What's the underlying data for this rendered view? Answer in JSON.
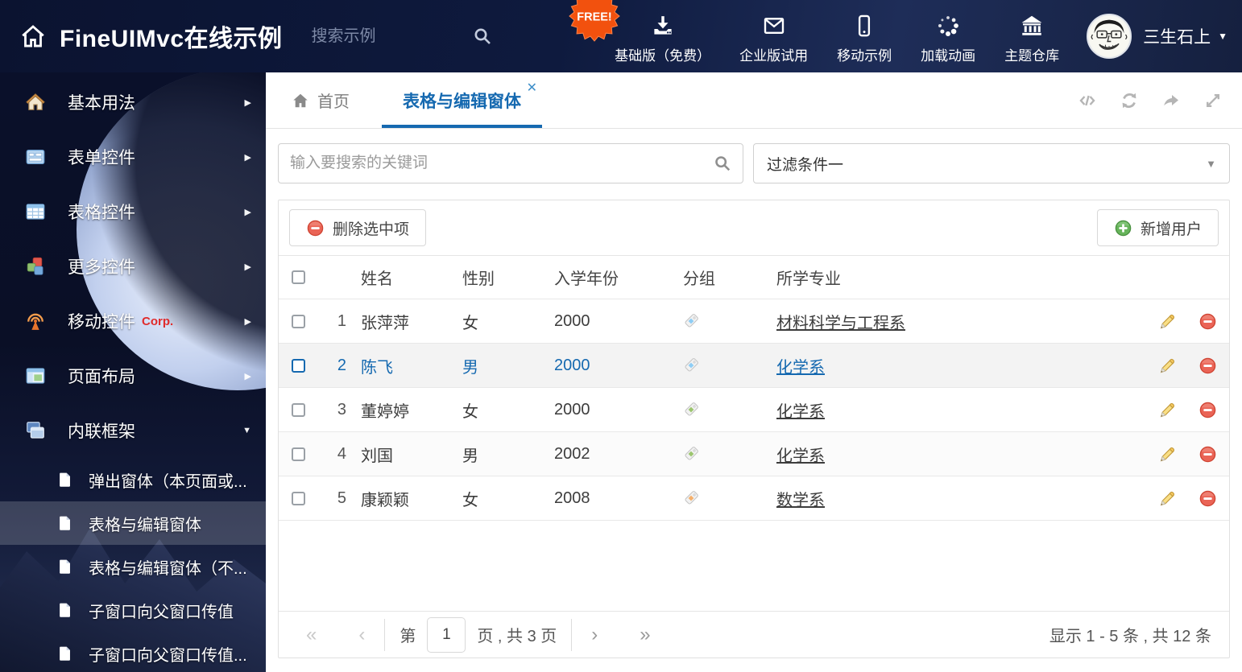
{
  "header": {
    "title": "FineUIMvc在线示例",
    "search_placeholder": "搜索示例",
    "nav": [
      {
        "id": "basic-free",
        "label": "基础版（免费）",
        "icon": "download-icon",
        "badge": "FREE!"
      },
      {
        "id": "enterprise",
        "label": "企业版试用",
        "icon": "envelope-icon"
      },
      {
        "id": "mobile-demo",
        "label": "移动示例",
        "icon": "mobile-icon"
      },
      {
        "id": "loading",
        "label": "加载动画",
        "icon": "spinner-icon"
      },
      {
        "id": "themes",
        "label": "主题仓库",
        "icon": "bank-icon"
      }
    ],
    "user_name": "三生石上"
  },
  "sidebar": {
    "items": [
      {
        "id": "basic",
        "label": "基本用法",
        "icon": "home-colored-icon"
      },
      {
        "id": "form",
        "label": "表单控件",
        "icon": "form-icon"
      },
      {
        "id": "grid",
        "label": "表格控件",
        "icon": "grid-icon"
      },
      {
        "id": "more",
        "label": "更多控件",
        "icon": "cubes-icon"
      },
      {
        "id": "mobile",
        "label": "移动控件",
        "icon": "signal-icon",
        "suffix": "Corp."
      },
      {
        "id": "layout",
        "label": "页面布局",
        "icon": "layout-icon"
      },
      {
        "id": "iframe",
        "label": "内联框架",
        "icon": "frames-icon",
        "expanded": true
      }
    ],
    "subitems": [
      {
        "id": "popup-window",
        "label": "弹出窗体（本页面或..."
      },
      {
        "id": "grid-edit-window",
        "label": "表格与编辑窗体",
        "selected": true
      },
      {
        "id": "grid-edit-window-2",
        "label": "表格与编辑窗体（不..."
      },
      {
        "id": "child-to-parent",
        "label": "子窗口向父窗口传值"
      },
      {
        "id": "child-to-parent-2",
        "label": "子窗口向父窗口传值..."
      }
    ]
  },
  "tabs": {
    "home_label": "首页",
    "active_label": "表格与编辑窗体"
  },
  "filters": {
    "search_placeholder": "输入要搜索的关键词",
    "dropdown_value": "过滤条件一"
  },
  "toolbar": {
    "delete_label": "删除选中项",
    "add_label": "新增用户"
  },
  "table": {
    "headers": {
      "name": "姓名",
      "gender": "性别",
      "year": "入学年份",
      "group": "分组",
      "major": "所学专业"
    },
    "rows": [
      {
        "num": "1",
        "name": "张萍萍",
        "gender": "女",
        "year": "2000",
        "tag": "blue",
        "major": "材料科学与工程系",
        "selected": false
      },
      {
        "num": "2",
        "name": "陈飞",
        "gender": "男",
        "year": "2000",
        "tag": "blue",
        "major": "化学系",
        "selected": true
      },
      {
        "num": "3",
        "name": "董婷婷",
        "gender": "女",
        "year": "2000",
        "tag": "green",
        "major": "化学系",
        "selected": false
      },
      {
        "num": "4",
        "name": "刘国",
        "gender": "男",
        "year": "2002",
        "tag": "green",
        "major": "化学系",
        "selected": false
      },
      {
        "num": "5",
        "name": "康颖颖",
        "gender": "女",
        "year": "2008",
        "tag": "orange",
        "major": "数学系",
        "selected": false
      }
    ]
  },
  "pagination": {
    "page_prefix": "第",
    "page_value": "1",
    "page_label": "页 , 共 3 页",
    "summary": "显示 1 - 5 条 , 共 12 条"
  },
  "colors": {
    "accent": "#1569b0",
    "danger": "#e2574c",
    "success": "#5aae50",
    "tag_blue": "#8ecdf5",
    "tag_green": "#9cc56e",
    "tag_orange": "#f5b06c"
  }
}
